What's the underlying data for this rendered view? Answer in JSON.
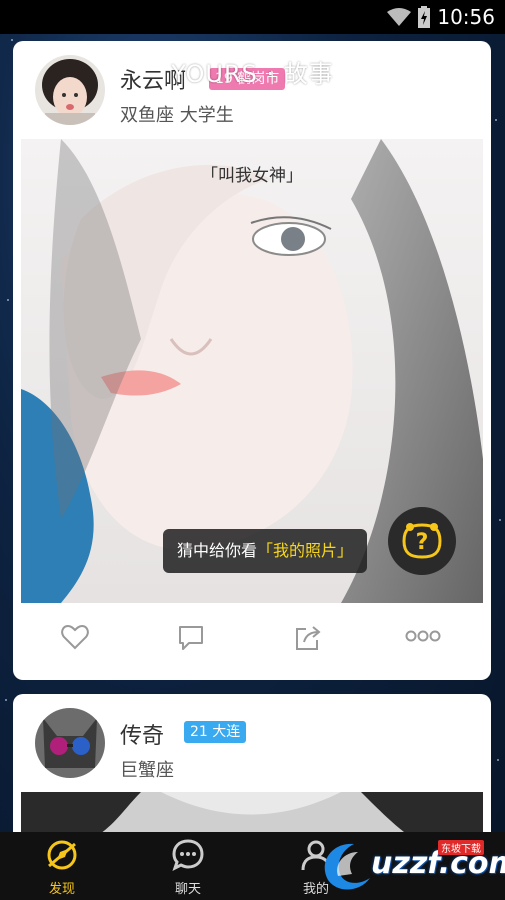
{
  "status_bar": {
    "time": "10:56"
  },
  "header": {
    "title": "YOURS · 故事"
  },
  "cards": [
    {
      "name": "永云啊",
      "badge": "19 鹤岗市",
      "subtitle": "双鱼座 大学生",
      "photo_quote": "「叫我女神」",
      "guess_prefix": "猜中给你看",
      "guess_highlight": "「我的照片」",
      "question_mark": "?"
    },
    {
      "name": "传奇",
      "badge": "21 大连",
      "subtitle": "巨蟹座"
    }
  ],
  "bottom_nav": [
    {
      "label": "发现",
      "icon": "discover-icon"
    },
    {
      "label": "聊天",
      "icon": "chat-icon"
    },
    {
      "label": "我的",
      "icon": "profile-icon"
    }
  ],
  "watermark": {
    "text": "uzzf.com",
    "small": "东坡下载"
  },
  "colors": {
    "accent": "#f7c61a",
    "badge_pink": "#ef7ab0",
    "badge_blue": "#39a9f0"
  }
}
